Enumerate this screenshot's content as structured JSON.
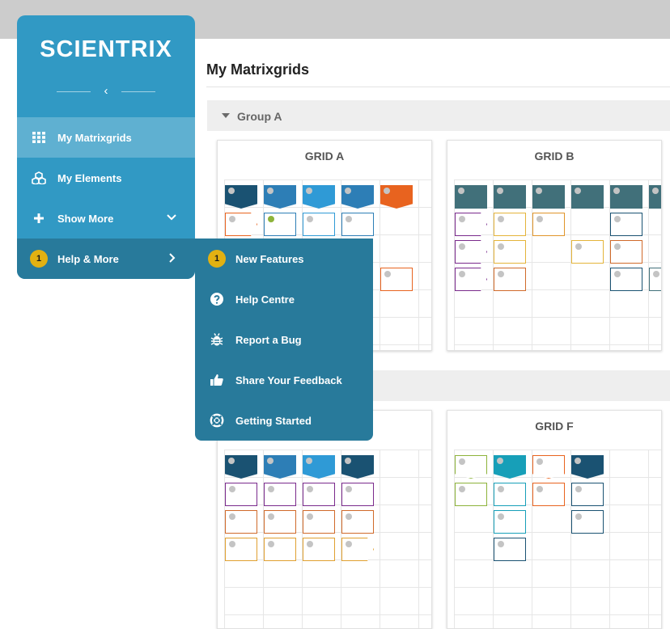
{
  "app": {
    "logo": "SCIENTRIX"
  },
  "page": {
    "title": "My Matrixgrids"
  },
  "sidebar": {
    "items": [
      {
        "label": "My Matrixgrids",
        "icon": "grid-icon"
      },
      {
        "label": "My Elements",
        "icon": "cubes-icon"
      },
      {
        "label": "Show More",
        "icon": "plus-icon"
      },
      {
        "label": "Help & More",
        "icon": "badge",
        "badge": "1"
      }
    ]
  },
  "submenu": {
    "items": [
      {
        "label": "New Features",
        "badge": "1"
      },
      {
        "label": "Help Centre",
        "icon": "question-circle-icon"
      },
      {
        "label": "Report a Bug",
        "icon": "bug-icon"
      },
      {
        "label": "Share Your Feedback",
        "icon": "thumbs-up-icon"
      },
      {
        "label": "Getting Started",
        "icon": "life-ring-icon"
      }
    ]
  },
  "groups": [
    {
      "title": "Group A"
    }
  ],
  "grids": [
    {
      "name": "GRID A"
    },
    {
      "name": "GRID B"
    },
    {
      "name": ""
    },
    {
      "name": "GRID F"
    }
  ],
  "colors": {
    "sidebar": "#3199c4",
    "sidebar_active": "#5fb0d1",
    "submenu": "#287a9b",
    "badge": "#e2b112",
    "navy": "#1a5272",
    "mid_blue": "#2d7eb6",
    "bright_blue": "#2f9ad6",
    "orange": "#e8631f",
    "teal_gray": "#41707a",
    "teal": "#179fb8"
  }
}
